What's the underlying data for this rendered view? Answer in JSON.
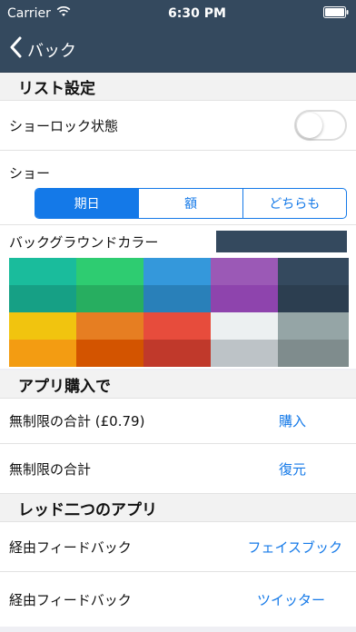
{
  "status": {
    "carrier": "Carrier",
    "time": "6:30 PM"
  },
  "nav": {
    "back_label": "バック"
  },
  "section_list": {
    "title": "リスト設定",
    "lock_label": "ショーロック状態",
    "lock_on": false,
    "show_label": "ショー",
    "segments": [
      "期日",
      "額",
      "どちらも"
    ],
    "selected_segment": 0,
    "bg_color_label": "バックグラウンドカラー",
    "current_color": "#34495e",
    "palette": [
      [
        "#1abc9c",
        "#2ecc71",
        "#3498db",
        "#9b59b6",
        "#34495e"
      ],
      [
        "#16a085",
        "#27ae60",
        "#2980b9",
        "#8e44ad",
        "#2c3e50"
      ],
      [
        "#f1c40f",
        "#e67e22",
        "#e74c3c",
        "#ecf0f1",
        "#95a5a6"
      ],
      [
        "#f39c12",
        "#d35400",
        "#c0392b",
        "#bdc3c7",
        "#7f8c8d"
      ]
    ]
  },
  "section_purchase": {
    "title": "アプリ購入で",
    "rows": [
      {
        "label": "無制限の合計 (£0.79)",
        "action": "購入"
      },
      {
        "label": "無制限の合計",
        "action": "復元"
      }
    ]
  },
  "section_apps": {
    "title": "レッド二つのアプリ",
    "rows": [
      {
        "label": "経由フィードバック",
        "action": "フェイスブック"
      },
      {
        "label": "経由フィードバック",
        "action": "ツイッター"
      }
    ]
  },
  "colors": {
    "accent": "#1479e8",
    "navbar": "#34495e"
  }
}
